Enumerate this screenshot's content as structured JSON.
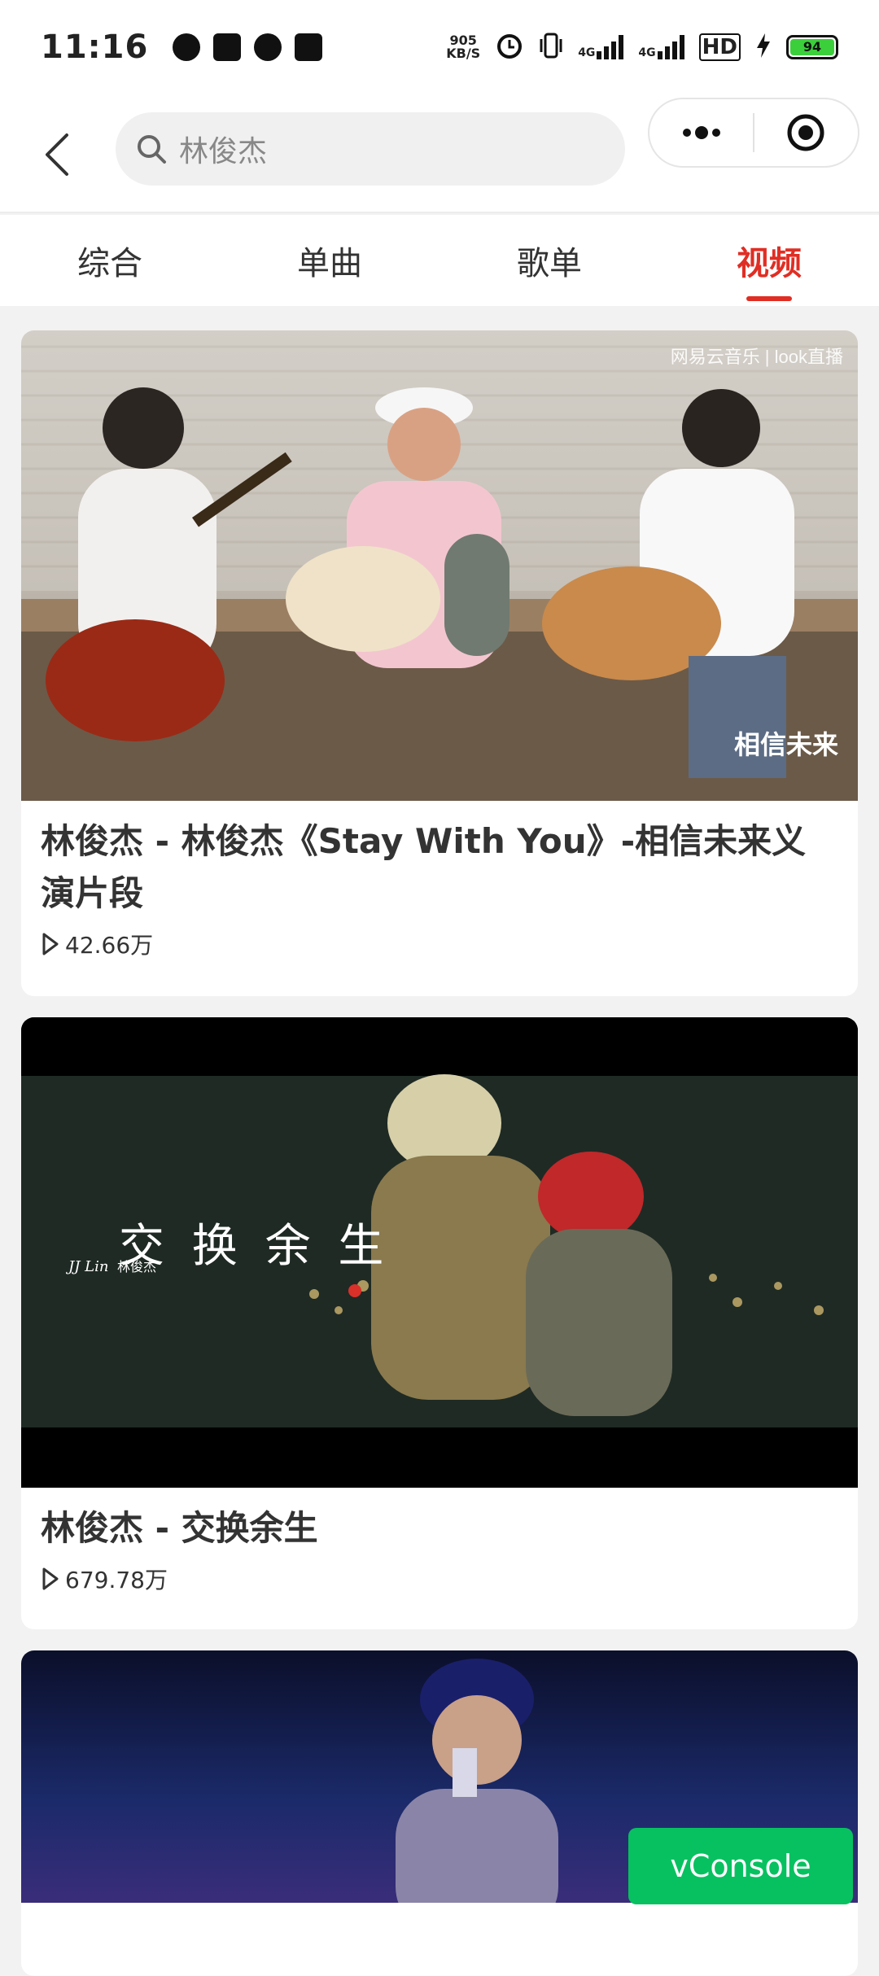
{
  "status_bar": {
    "time": "11:16",
    "net_speed_value": "905",
    "net_speed_unit": "KB/S",
    "network_1": "4G",
    "network_2": "4G",
    "hd_label": "HD",
    "battery": "94"
  },
  "header": {
    "search_text": "林俊杰",
    "capsule_more": "•••"
  },
  "tabs": [
    {
      "label": "综合",
      "active": false
    },
    {
      "label": "单曲",
      "active": false
    },
    {
      "label": "歌单",
      "active": false
    },
    {
      "label": "视频",
      "active": true
    }
  ],
  "videos": [
    {
      "title": "林俊杰 - 林俊杰《Stay With You》-相信未来义演片段",
      "plays": "42.66万",
      "watermark": "网易云音乐 | look直播",
      "overlay_logo": "相信未来"
    },
    {
      "title": "林俊杰 - 交换余生",
      "plays": "679.78万",
      "overlay_artist_en": "JJ Lin",
      "overlay_artist_cn": "林俊杰",
      "overlay_song": "交 换 余 生"
    },
    {
      "title": "",
      "plays": ""
    }
  ],
  "vconsole_label": "vConsole"
}
